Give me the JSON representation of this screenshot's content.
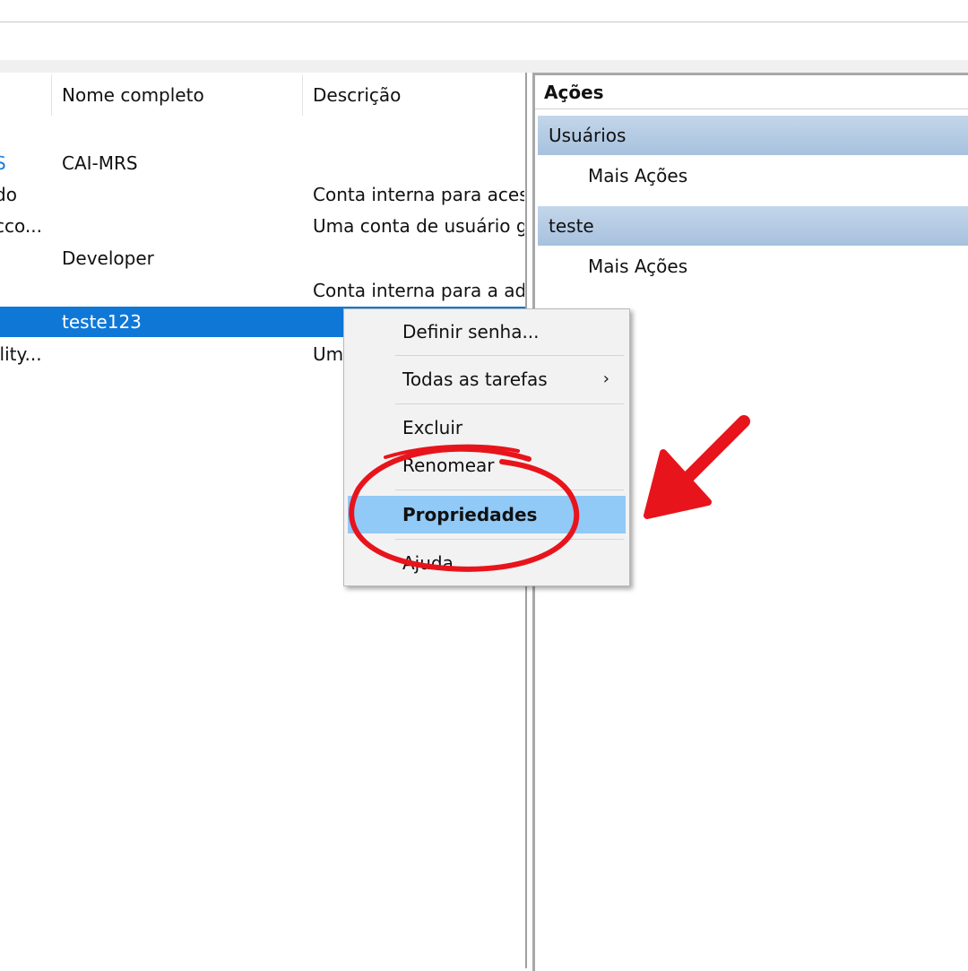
{
  "list": {
    "columns": [
      "Nome completo",
      "Descrição"
    ],
    "rows": [
      {
        "c0": "S",
        "c1": "CAI-MRS",
        "c2": ""
      },
      {
        "c0": "do",
        "c1": "",
        "c2": "Conta interna para aces"
      },
      {
        "c0": "cco...",
        "c1": "",
        "c2": "Uma conta de usuário g"
      },
      {
        "c0": "",
        "c1": "Developer",
        "c2": ""
      },
      {
        "c0": "",
        "c1": "",
        "c2": "Conta interna para a adr"
      },
      {
        "c0": "",
        "c1": "teste123",
        "c2": ""
      },
      {
        "c0": "ility...",
        "c1": "",
        "c2": "Um"
      }
    ]
  },
  "actions": {
    "title": "Ações",
    "groups": [
      {
        "header": "Usuários",
        "item": "Mais Ações"
      },
      {
        "header": "teste",
        "item": "Mais Ações"
      }
    ]
  },
  "context_menu": {
    "items": [
      "Definir senha...",
      "Todas as tarefas",
      "Excluir",
      "Renomear",
      "Propriedades",
      "Ajuda"
    ],
    "submenu_chevron": "›"
  },
  "colors": {
    "selection": "#0f78d7",
    "menu_highlight": "#91c9f7",
    "annotation": "#e8141c"
  }
}
